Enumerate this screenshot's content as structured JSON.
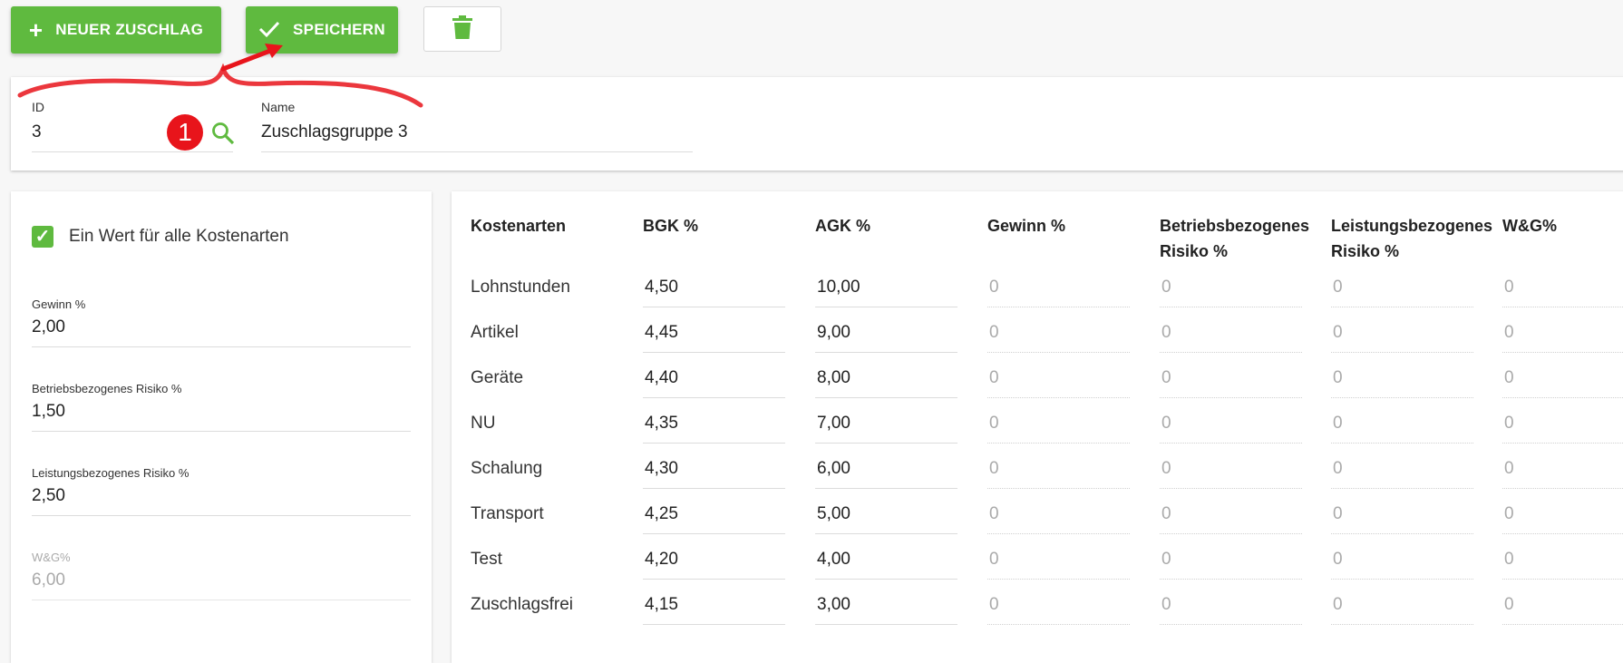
{
  "toolbar": {
    "new_label": "NEUER ZUSCHLAG",
    "new_icon": "plus-icon",
    "save_label": "SPEICHERN",
    "save_icon": "check-icon",
    "delete_icon": "trash-icon"
  },
  "header": {
    "id_label": "ID",
    "id_value": "3",
    "name_label": "Name",
    "name_value": "Zuschlagsgruppe 3",
    "badge": "1",
    "search_icon": "search-icon"
  },
  "left": {
    "checkbox_label": "Ein Wert für alle Kostenarten",
    "checked": true,
    "fields": [
      {
        "label": "Gewinn %",
        "value": "2,00"
      },
      {
        "label": "Betriebsbezogenes Risiko %",
        "value": "1,50"
      },
      {
        "label": "Leistungsbezogenes Risiko %",
        "value": "2,50"
      },
      {
        "label": "W&G%",
        "value": "6,00"
      }
    ]
  },
  "table": {
    "headers": [
      "Kostenarten",
      "BGK %",
      "AGK %",
      "Gewinn %",
      "Betriebsbezogenes Risiko %",
      "Leistungsbezogenes Risiko %",
      "W&G%"
    ],
    "rows": [
      {
        "name": "Lohnstunden",
        "bgk": "4,50",
        "agk": "10,00",
        "gewinn": "0",
        "betrieb": "0",
        "leistung": "0",
        "wg": "0"
      },
      {
        "name": "Artikel",
        "bgk": "4,45",
        "agk": "9,00",
        "gewinn": "0",
        "betrieb": "0",
        "leistung": "0",
        "wg": "0"
      },
      {
        "name": "Geräte",
        "bgk": "4,40",
        "agk": "8,00",
        "gewinn": "0",
        "betrieb": "0",
        "leistung": "0",
        "wg": "0"
      },
      {
        "name": "NU",
        "bgk": "4,35",
        "agk": "7,00",
        "gewinn": "0",
        "betrieb": "0",
        "leistung": "0",
        "wg": "0"
      },
      {
        "name": "Schalung",
        "bgk": "4,30",
        "agk": "6,00",
        "gewinn": "0",
        "betrieb": "0",
        "leistung": "0",
        "wg": "0"
      },
      {
        "name": "Transport",
        "bgk": "4,25",
        "agk": "5,00",
        "gewinn": "0",
        "betrieb": "0",
        "leistung": "0",
        "wg": "0"
      },
      {
        "name": "Test",
        "bgk": "4,20",
        "agk": "4,00",
        "gewinn": "0",
        "betrieb": "0",
        "leistung": "0",
        "wg": "0"
      },
      {
        "name": "Zuschlagsfrei",
        "bgk": "4,15",
        "agk": "3,00",
        "gewinn": "0",
        "betrieb": "0",
        "leistung": "0",
        "wg": "0"
      }
    ]
  },
  "colors": {
    "accent": "#5fba3f",
    "annotation": "#e8141b"
  }
}
